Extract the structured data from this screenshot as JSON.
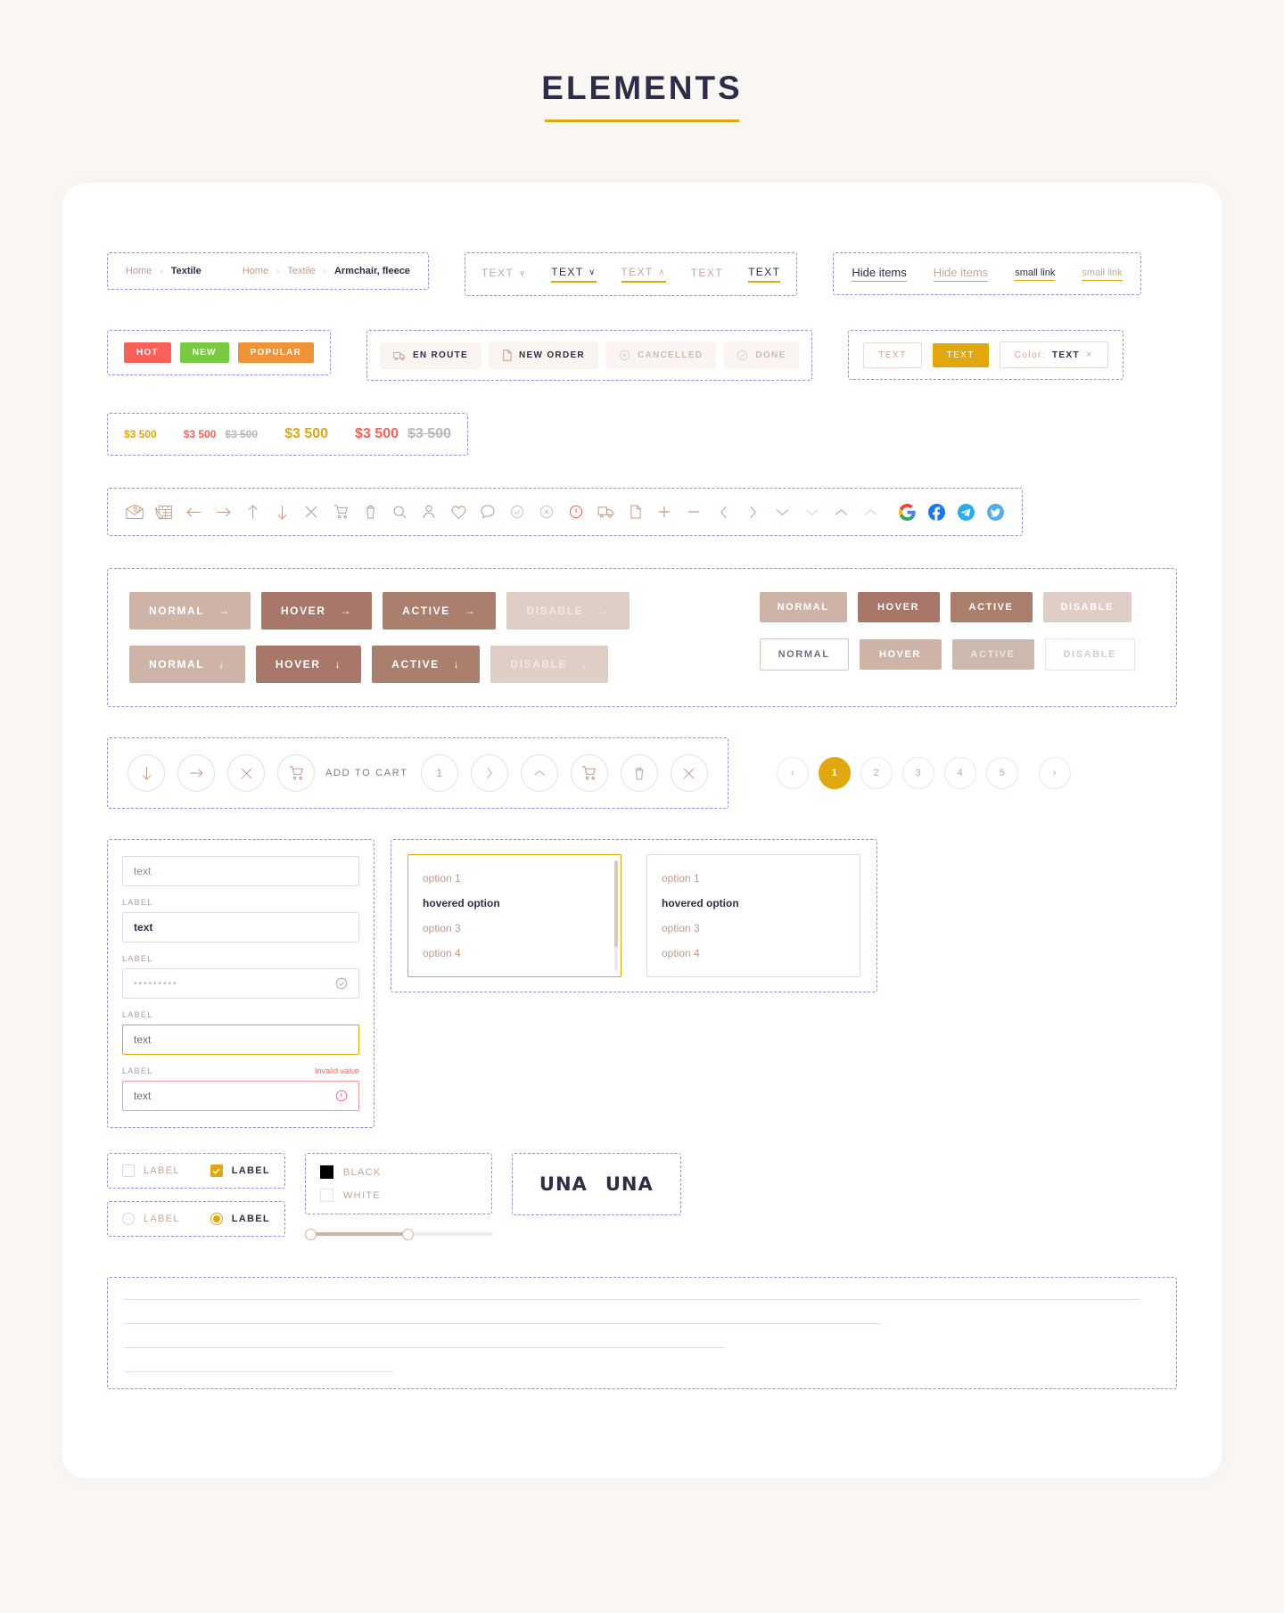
{
  "page": {
    "title": "ELEMENTS"
  },
  "breadcrumbs": {
    "short": {
      "home": "Home",
      "sep": "›",
      "current": "Textile"
    },
    "long": {
      "home": "Home",
      "sep": "›",
      "mid": "Textile",
      "current": "Armchair, fleece"
    }
  },
  "dropdown_texts": [
    {
      "label": "TEXT",
      "chevron": "∨",
      "state": "muted"
    },
    {
      "label": "TEXT",
      "chevron": "∨",
      "state": "dark-underline"
    },
    {
      "label": "TEXT",
      "chevron": "∧",
      "state": "muted-underline"
    },
    {
      "label": "TEXT",
      "chevron": "",
      "state": "muted"
    },
    {
      "label": "TEXT",
      "chevron": "",
      "state": "dark-underline"
    }
  ],
  "links": [
    {
      "label": "Hide items",
      "style": "dark"
    },
    {
      "label": "Hide items",
      "style": "muted"
    },
    {
      "label": "small link",
      "style": "dark-small"
    },
    {
      "label": "small link",
      "style": "muted-small"
    }
  ],
  "badges": [
    {
      "label": "HOT",
      "color": "#f8615a"
    },
    {
      "label": "NEW",
      "color": "#7ac943"
    },
    {
      "label": "POPULAR",
      "color": "#ef9338"
    }
  ],
  "status_chips": [
    {
      "label": "EN ROUTE",
      "icon": "truck-icon",
      "dim": false
    },
    {
      "label": "NEW ORDER",
      "icon": "file-icon",
      "dim": false
    },
    {
      "label": "CANCELLED",
      "icon": "x-circle-icon",
      "dim": true
    },
    {
      "label": "DONE",
      "icon": "check-circle-icon",
      "dim": true
    }
  ],
  "tags": {
    "outlined": "TEXT",
    "filled": "TEXT",
    "color_prefix": "Color:",
    "color_value": "TEXT",
    "close": "×"
  },
  "prices": {
    "small_gold": "$3 500",
    "small_red": "$3 500",
    "small_old": "$3 500",
    "large_gold": "$3 500",
    "large_red": "$3 500",
    "large_old": "$3 500"
  },
  "icons": [
    "envelope-email-icon",
    "calendar-phone-icon",
    "arrow-left-icon",
    "arrow-right-icon",
    "arrow-up-icon",
    "arrow-down-icon",
    "close-icon",
    "cart-icon",
    "trash-icon",
    "search-icon",
    "user-icon",
    "heart-icon",
    "chat-icon",
    "check-circle-icon",
    "x-circle-icon",
    "alert-circle-icon",
    "truck-icon",
    "file-icon",
    "plus-icon",
    "minus-icon",
    "chevron-left-icon",
    "chevron-right-icon",
    "chevron-down-icon",
    "chevron-down-thin-icon",
    "chevron-up-icon",
    "chevron-up-thin-icon",
    "google-icon",
    "facebook-icon",
    "telegram-icon",
    "twitter-icon"
  ],
  "buttons": {
    "arrow_row": [
      {
        "label": "NORMAL",
        "state": "normal",
        "arrow": "→"
      },
      {
        "label": "HOVER",
        "state": "hover",
        "arrow": "→"
      },
      {
        "label": "ACTIVE",
        "state": "active",
        "arrow": "→"
      },
      {
        "label": "DISABLE",
        "state": "disable",
        "arrow": "→"
      }
    ],
    "down_row": [
      {
        "label": "NORMAL",
        "state": "normal",
        "arrow": "↓"
      },
      {
        "label": "HOVER",
        "state": "hover",
        "arrow": "↓"
      },
      {
        "label": "ACTIVE",
        "state": "active",
        "arrow": "↓"
      },
      {
        "label": "DISABLE",
        "state": "disable",
        "arrow": "↓"
      }
    ],
    "small_filled": [
      {
        "label": "NORMAL",
        "state": "normal"
      },
      {
        "label": "HOVER",
        "state": "hover"
      },
      {
        "label": "ACTIVE",
        "state": "active"
      },
      {
        "label": "DISABLE",
        "state": "disable"
      }
    ],
    "small_outline": [
      {
        "label": "NORMAL",
        "state": "normal"
      },
      {
        "label": "HOVER",
        "state": "hover"
      },
      {
        "label": "ACTIVE",
        "state": "active"
      },
      {
        "label": "DISABLE",
        "state": "disable"
      }
    ]
  },
  "circle_buttons": {
    "items": [
      "arrow-down-icon",
      "arrow-right-icon",
      "close-icon"
    ],
    "add_to_cart_label": "ADD TO CART",
    "quantity": "1",
    "after": [
      "chevron-right-icon",
      "chevron-up-icon",
      "cart-icon",
      "trash-icon",
      "close-icon"
    ]
  },
  "pagination": {
    "prev": "‹",
    "pages": [
      "1",
      "2",
      "3",
      "4",
      "5"
    ],
    "active": "1",
    "next": "›"
  },
  "form": {
    "field1": {
      "placeholder": "text",
      "value": ""
    },
    "field2": {
      "label": "LABEL",
      "value": "text"
    },
    "field3": {
      "label": "LABEL",
      "value": "•••••••••",
      "icon": "check-circle-icon"
    },
    "field4": {
      "label": "LABEL",
      "value": "text",
      "state": "focus"
    },
    "field5": {
      "label": "LABEL",
      "value": "text",
      "state": "invalid",
      "error": "Invalid value",
      "icon": "alert-circle-icon"
    }
  },
  "dropdown_lists": {
    "focused": {
      "options": [
        "option 1",
        "hovered option",
        "option 3",
        "option 4"
      ],
      "hovered_index": 1
    },
    "plain": {
      "options": [
        "option 1",
        "hovered option",
        "option 3",
        "option 4"
      ],
      "hovered_index": 1
    }
  },
  "checkboxes": [
    {
      "label": "LABEL",
      "checked": false
    },
    {
      "label": "LABEL",
      "checked": true
    }
  ],
  "radios": [
    {
      "label": "LABEL",
      "selected": false
    },
    {
      "label": "LABEL",
      "selected": true
    }
  ],
  "swatches": [
    {
      "label": "BLACK",
      "color": "#000000",
      "selected": true
    },
    {
      "label": "WHITE",
      "color": "#ffffff",
      "selected": false
    }
  ],
  "logo": {
    "dark": "UNA",
    "light": "UNA"
  },
  "slider": {
    "value_percent": 55
  },
  "colors": {
    "gold": "#e0a70f",
    "brown": "#c49a86",
    "dark": "#2d2d48",
    "red": "#f8615a",
    "green": "#7ac943",
    "orange": "#ef9338",
    "page_bg": "#faf6f3"
  }
}
